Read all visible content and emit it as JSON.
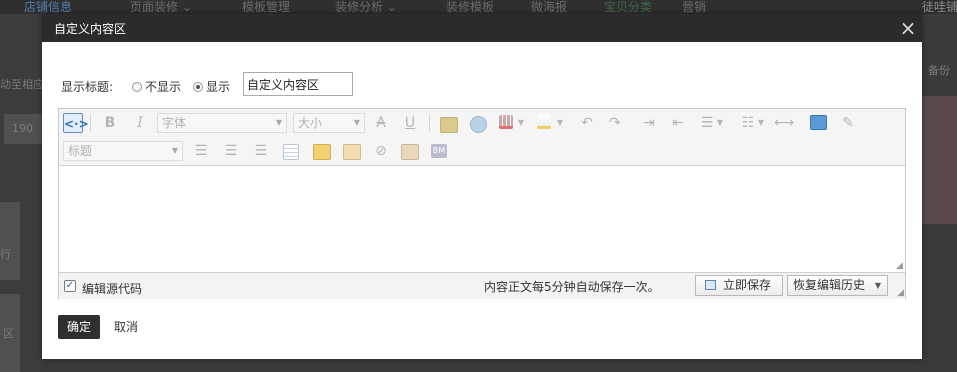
{
  "background": {
    "nav_items": [
      "店铺信息",
      "页面装修 ⌄",
      "模板管理",
      "装修分析 ⌄",
      "装修模板",
      "微海报",
      "宝贝分类",
      "营销"
    ],
    "right_nav": "徒哇铺",
    "left_texts": [
      "动至相应",
      "190",
      "行",
      "区"
    ],
    "right_texts": [
      "备份"
    ]
  },
  "dialog": {
    "title": "自定义内容区",
    "close_glyph": "×",
    "title_label": "显示标题:",
    "radio_hide_label": "不显示",
    "radio_show_label": "显示",
    "radio_selected": "show",
    "title_input_value": "自定义内容区",
    "toolbar": {
      "source_icon": "<·>",
      "bold": "B",
      "italic": "I",
      "font_select": "字体",
      "size_select": "大小",
      "strikethrough": "A",
      "underline": "U",
      "heading_select": "标题",
      "bm": "BM"
    },
    "footer": {
      "source_checkbox_checked": true,
      "source_label": "编辑源代码",
      "autosave_text": "内容正文每5分钟自动保存一次。",
      "save_now": "立即保存",
      "restore_history": "恢复编辑历史"
    },
    "ok_button": "确定",
    "cancel_button": "取消"
  },
  "colors": {
    "header_bg": "#2b2b2b",
    "ok_button_bg": "#2f2f2f",
    "overlay_bg": "#4a4a4a",
    "active_tool_border": "#5b8fc7"
  }
}
